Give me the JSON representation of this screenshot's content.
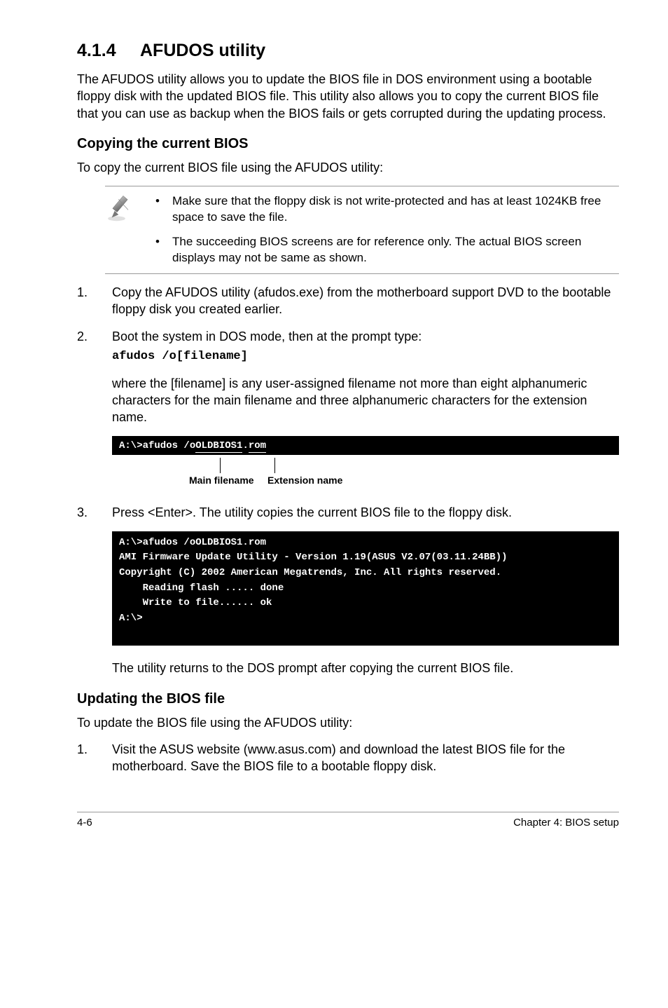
{
  "heading": {
    "num": "4.1.4",
    "title": "AFUDOS utility"
  },
  "intro": "The AFUDOS utility allows you to update the BIOS file in DOS environment using a bootable floppy disk with the updated BIOS file. This utility also allows you to copy the current BIOS file that you can use as backup when the BIOS fails or gets corrupted during the updating process.",
  "copy": {
    "heading": "Copying the current BIOS",
    "lead": "To copy the current BIOS file using the AFUDOS utility:",
    "note1": "Make sure that the floppy disk is not write-protected and has at least 1024KB free space to save the file.",
    "note2": "The succeeding BIOS screens are for reference only. The actual BIOS screen displays may not be same as shown.",
    "step1": "Copy the AFUDOS utility (afudos.exe) from the motherboard support DVD to the bootable floppy disk you created earlier.",
    "step2": "Boot the system in DOS mode, then at the prompt type:",
    "step2code": "afudos /o[filename]",
    "step2b": "where the [filename] is any user-assigned filename not more than eight alphanumeric characters  for the main filename and three alphanumeric characters for the extension name.",
    "term1_prefix": "A:\\>afudos /o",
    "term1_main": "OLDBIOS1",
    "term1_dot": ".",
    "term1_ext": "rom",
    "annot_main": "Main filename",
    "annot_ext": "Extension name",
    "step3": "Press <Enter>. The utility copies the current BIOS file to the floppy disk.",
    "term2": "A:\\>afudos /oOLDBIOS1.rom\nAMI Firmware Update Utility - Version 1.19(ASUS V2.07(03.11.24BB))\nCopyright (C) 2002 American Megatrends, Inc. All rights reserved.\n    Reading flash ..... done\n    Write to file...... ok\nA:\\>\n ",
    "after2": "The utility returns to the DOS prompt after copying the current BIOS file."
  },
  "update": {
    "heading": "Updating the BIOS file",
    "lead": "To update the BIOS file using the AFUDOS utility:",
    "step1": "Visit the ASUS website (www.asus.com) and download the latest BIOS file for the motherboard. Save the BIOS file to a bootable floppy disk."
  },
  "footer": {
    "left": "4-6",
    "right": "Chapter 4: BIOS setup"
  }
}
